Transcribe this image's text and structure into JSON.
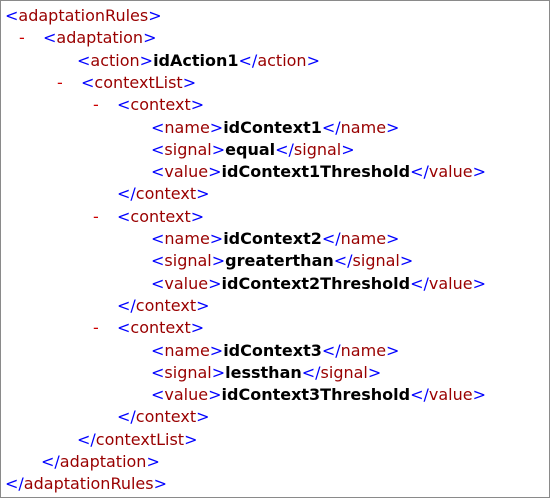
{
  "xml_viewer": {
    "lines": [
      {
        "indent": 4,
        "kind": "open",
        "tag": "adaptationRules"
      },
      {
        "indent": 18,
        "kind": "open",
        "tag": "adaptation",
        "toggle": "-"
      },
      {
        "indent": 76,
        "kind": "leaf",
        "tag": "action",
        "text": "idAction1"
      },
      {
        "indent": 56,
        "kind": "open",
        "tag": "contextList",
        "toggle": "-"
      },
      {
        "indent": 92,
        "kind": "open",
        "tag": "context",
        "toggle": "-"
      },
      {
        "indent": 150,
        "kind": "leaf",
        "tag": "name",
        "text": "idContext1"
      },
      {
        "indent": 150,
        "kind": "leaf",
        "tag": "signal",
        "text": "equal"
      },
      {
        "indent": 150,
        "kind": "leaf",
        "tag": "value",
        "text": "idContext1Threshold"
      },
      {
        "indent": 116,
        "kind": "close",
        "tag": "context"
      },
      {
        "indent": 92,
        "kind": "open",
        "tag": "context",
        "toggle": "-"
      },
      {
        "indent": 150,
        "kind": "leaf",
        "tag": "name",
        "text": "idContext2"
      },
      {
        "indent": 150,
        "kind": "leaf",
        "tag": "signal",
        "text": "greaterthan"
      },
      {
        "indent": 150,
        "kind": "leaf",
        "tag": "value",
        "text": "idContext2Threshold"
      },
      {
        "indent": 116,
        "kind": "close",
        "tag": "context"
      },
      {
        "indent": 92,
        "kind": "open",
        "tag": "context",
        "toggle": "-"
      },
      {
        "indent": 150,
        "kind": "leaf",
        "tag": "name",
        "text": "idContext3"
      },
      {
        "indent": 150,
        "kind": "leaf",
        "tag": "signal",
        "text": "lessthan"
      },
      {
        "indent": 150,
        "kind": "leaf",
        "tag": "value",
        "text": "idContext3Threshold"
      },
      {
        "indent": 116,
        "kind": "close",
        "tag": "context"
      },
      {
        "indent": 76,
        "kind": "close",
        "tag": "contextList"
      },
      {
        "indent": 40,
        "kind": "close",
        "tag": "adaptation"
      },
      {
        "indent": 4,
        "kind": "close",
        "tag": "adaptationRules"
      }
    ]
  },
  "colors": {
    "bracket": "#0000ff",
    "tagname": "#990000",
    "toggle": "#cc0000",
    "text": "#000000"
  }
}
